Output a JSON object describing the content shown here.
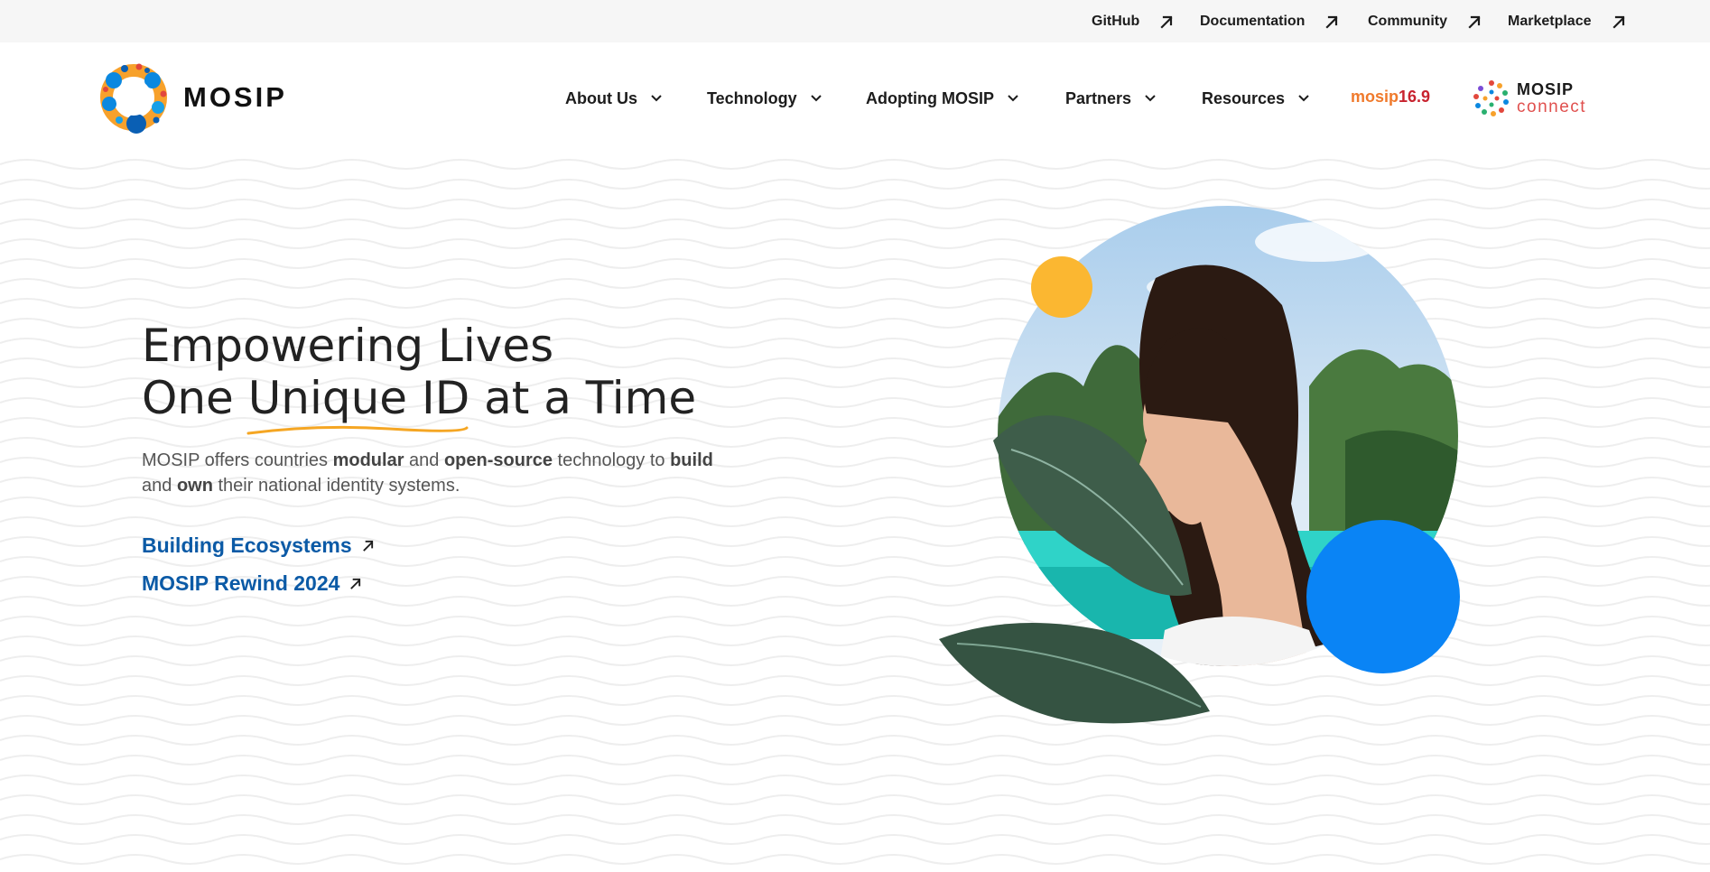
{
  "utility_bar": {
    "links": [
      {
        "label": "GitHub",
        "icon": "external-arrow-icon"
      },
      {
        "label": "Documentation",
        "icon": "external-arrow-icon"
      },
      {
        "label": "Community",
        "icon": "external-arrow-icon"
      },
      {
        "label": "Marketplace",
        "icon": "external-arrow-icon"
      }
    ]
  },
  "header": {
    "logo_text": "MOSIP",
    "nav": [
      {
        "label": "About Us",
        "icon": "chevron-down-icon"
      },
      {
        "label": "Technology",
        "icon": "chevron-down-icon"
      },
      {
        "label": "Adopting MOSIP",
        "icon": "chevron-down-icon"
      },
      {
        "label": "Partners",
        "icon": "chevron-down-icon"
      },
      {
        "label": "Resources",
        "icon": "chevron-down-icon"
      }
    ],
    "version_badge": {
      "part1": "mosip",
      "part2": "16.9"
    },
    "connect_logo": {
      "line1": "MOSIP",
      "line2": "connect"
    }
  },
  "hero": {
    "title_line1": "Empowering Lives",
    "title_line2_before": "One ",
    "title_line2_highlight": "Unique ID",
    "title_line2_after": " at a Time",
    "description": {
      "t1": "MOSIP offers countries ",
      "b1": "modular",
      "t2": " and ",
      "b2": "open-source",
      "t3": " technology to ",
      "b3": "build",
      "t4": " and ",
      "b4": "own",
      "t5": " their national identity systems."
    },
    "links": [
      {
        "label": "Building Ecosystems",
        "icon": "external-arrow-icon"
      },
      {
        "label": "MOSIP Rewind 2024",
        "icon": "external-arrow-icon"
      }
    ]
  },
  "colors": {
    "accent_link": "#0b5aa6",
    "brand_orange": "#f07a2c",
    "brand_red": "#c8232f",
    "underline": "#f5a623",
    "circle_yellow": "#fbb731",
    "circle_blue": "#0a84f5",
    "leaf_green": "#3e5d4a"
  }
}
